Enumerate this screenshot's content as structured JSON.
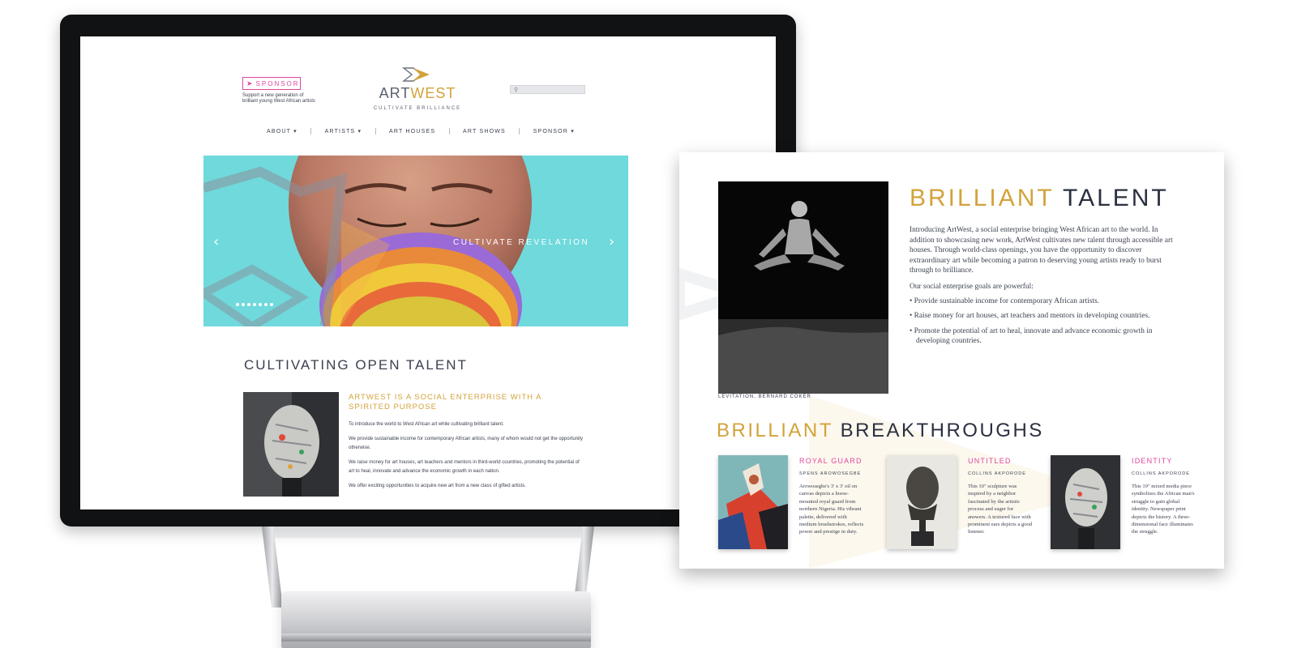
{
  "site": {
    "sponsor_badge": "SPONSOR",
    "sponsor_sub": "Support a new generation of brilliant young West African artists",
    "logo_part1": "ART",
    "logo_part2": "WEST",
    "tagline": "CULTIVATE BRILLIANCE",
    "search_placeholder": "",
    "nav": [
      "ABOUT ▾",
      "ARTISTS ▾",
      "ART HOUSES",
      "ART SHOWS",
      "SPONSOR ▾"
    ],
    "hero_caption": "CULTIVATE REVELATION",
    "hero_slide_count": 7,
    "section_title": "CULTIVATING OPEN TALENT",
    "article_heading": "ARTWEST IS A SOCIAL ENTERPRISE WITH A SPIRITED PURPOSE",
    "article_paragraphs": [
      "To introduce the world to West African art while cultivating brilliant talent.",
      "We provide sustainable income for contemporary African artists, many of whom would not get the opportunity otherwise.",
      "We raise money for art houses, art teachers and mentors in third-world countries, promoting the potential of art to heal, innovate and advance the economic growth in each nation.",
      "We offer exciting opportunities to acquire new art from a new class of gifted artists."
    ]
  },
  "doc": {
    "title_part1": "BRILLIANT",
    "title_part2": "TALENT",
    "intro": "Introducing ArtWest, a social enterprise bringing West African art to the world. In addition to showcasing new work, ArtWest cultivates new talent through accessible art houses. Through world-class openings, you have the opportunity to discover extraordinary art while becoming a patron to deserving young artists ready to burst through to brilliance.",
    "goals_intro": "Our social enterprise goals are powerful:",
    "goals": [
      "Provide sustainable income for contemporary African artists.",
      "Raise money for art houses, art teachers and mentors in developing countries.",
      "Promote the potential of art to heal, innovate and advance economic growth in developing countries."
    ],
    "photo_caption": "LEVITATION, BERNARD COKER",
    "title2_part1": "BRILLIANT",
    "title2_part2": "BREAKTHROUGHS",
    "cards": [
      {
        "title": "ROYAL GUARD",
        "artist": "SPENS AROWOSEGBE",
        "desc": "Arowosegbe's 3' x 3' oil on canvas depicts a horse-mounted royal guard from northern Nigeria. His vibrant palette, delivered with medium brushstrokes, reflects power and prestige in duty."
      },
      {
        "title": "UNTITLED",
        "artist": "COLLINS AKPORODE",
        "desc": "This 10\" sculpture was inspired by a neighbor fascinated by the artistic process and eager for answers. A textured face with prominent ears depicts a good listener."
      },
      {
        "title": "IDENTITY",
        "artist": "COLLINS AKPORODE",
        "desc": "This 19\" mixed media piece symbolizes the African man's struggle to gain global identity. Newspaper print depicts the history. A three-dimensional face illuminates the struggle."
      }
    ]
  },
  "colors": {
    "gold": "#d3a23a",
    "navy": "#2a3040",
    "pink": "#e0479e",
    "hero_teal": "#6fd9dc"
  }
}
